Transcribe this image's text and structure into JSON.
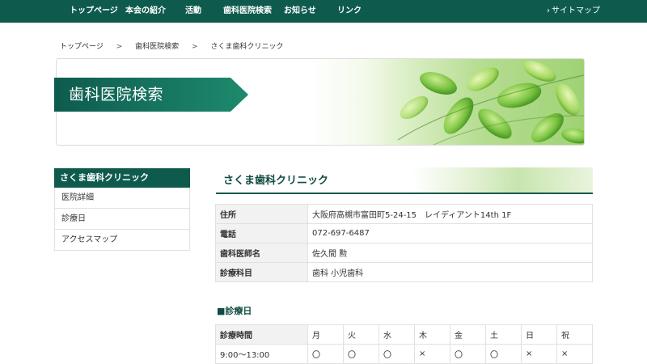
{
  "topnav": {
    "items": [
      "トップページ",
      "本会の紹介",
      "活動",
      "歯科医院検索",
      "お知らせ",
      "リンク"
    ],
    "sitemap": "サイトマップ",
    "sitemap_icon": "chevron-right-icon",
    "bg_color": "#0e5b4e"
  },
  "breadcrumb": {
    "items": [
      "トップページ",
      "歯科医院検索",
      "さくま歯科クリニック"
    ],
    "separator": ">"
  },
  "hero": {
    "title": "歯科医院検索",
    "image": "green-leaves-icon"
  },
  "sidebar": {
    "heading": "さくま歯科クリニック",
    "links": [
      "医院詳細",
      "診療日",
      "アクセスマップ"
    ]
  },
  "clinic": {
    "name": "さくま歯科クリニック",
    "info": [
      {
        "label": "住所",
        "value": "大阪府高槻市富田町5-24-15　レイディアント14th 1F"
      },
      {
        "label": "電話",
        "value": "072-697-6487"
      },
      {
        "label": "歯科医師名",
        "value": "佐久間 勲"
      },
      {
        "label": "診療科目",
        "value": "歯科 小児歯科"
      }
    ]
  },
  "schedule": {
    "heading": "■診療日",
    "header_label": "診療時間",
    "days": [
      "月",
      "火",
      "水",
      "木",
      "金",
      "土",
      "日",
      "祝"
    ],
    "rows": [
      {
        "time": "9:00〜13:00",
        "marks": [
          "〇",
          "〇",
          "〇",
          "×",
          "〇",
          "〇",
          "×",
          "×"
        ]
      }
    ]
  },
  "colors": {
    "brand_green": "#0e5b4e",
    "header_text": "#0e4b40",
    "table_header_bg": "#f2f2f2",
    "border": "#e1e1e1"
  }
}
